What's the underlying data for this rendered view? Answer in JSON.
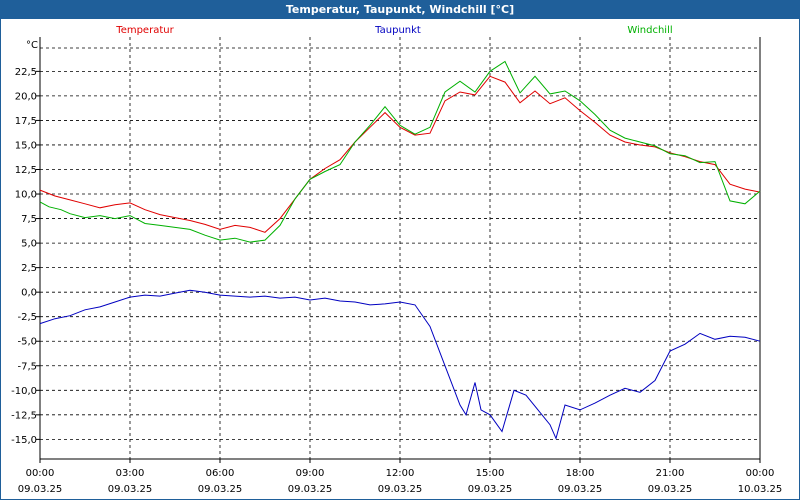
{
  "window": {
    "title": "Temperatur, Taupunkt, Windchill [°C]"
  },
  "chart_data": {
    "type": "line",
    "title": "Temperatur, Taupunkt, Windchill [°C]",
    "ylabel": "°C",
    "ylim": [
      -17,
      26
    ],
    "xlim": [
      0,
      24
    ],
    "grid": true,
    "legend_position": "top",
    "y_ticks": [
      {
        "value": 22.5,
        "label": "22,5"
      },
      {
        "value": 20.0,
        "label": "20,0"
      },
      {
        "value": 17.5,
        "label": "17,5"
      },
      {
        "value": 15.0,
        "label": "15,0"
      },
      {
        "value": 12.5,
        "label": "12,5"
      },
      {
        "value": 10.0,
        "label": "10,0"
      },
      {
        "value": 7.5,
        "label": "7,5"
      },
      {
        "value": 5.0,
        "label": "5,0"
      },
      {
        "value": 2.5,
        "label": "2,5"
      },
      {
        "value": 0.0,
        "label": "0,0"
      },
      {
        "value": -2.5,
        "label": "-2,5"
      },
      {
        "value": -5.0,
        "label": "-5,0"
      },
      {
        "value": -7.5,
        "label": "-7,5"
      },
      {
        "value": -10.0,
        "label": "-10,0"
      },
      {
        "value": -12.5,
        "label": "-12,5"
      },
      {
        "value": -15.0,
        "label": "-15,0"
      }
    ],
    "x_ticks": [
      {
        "value": 0,
        "time": "00:00",
        "date": "09.03.25"
      },
      {
        "value": 3,
        "time": "03:00",
        "date": "09.03.25"
      },
      {
        "value": 6,
        "time": "06:00",
        "date": "09.03.25"
      },
      {
        "value": 9,
        "time": "09:00",
        "date": "09.03.25"
      },
      {
        "value": 12,
        "time": "12:00",
        "date": "09.03.25"
      },
      {
        "value": 15,
        "time": "15:00",
        "date": "09.03.25"
      },
      {
        "value": 18,
        "time": "18:00",
        "date": "09.03.25"
      },
      {
        "value": 21,
        "time": "21:00",
        "date": "09.03.25"
      },
      {
        "value": 24,
        "time": "00:00",
        "date": "10.03.25"
      }
    ],
    "series": [
      {
        "name": "Temperatur",
        "color": "#e00000",
        "points": [
          [
            0,
            10.4
          ],
          [
            0.5,
            9.8
          ],
          [
            1,
            9.4
          ],
          [
            1.5,
            9.0
          ],
          [
            2,
            8.6
          ],
          [
            2.5,
            8.9
          ],
          [
            3,
            9.1
          ],
          [
            3.5,
            8.4
          ],
          [
            4,
            7.9
          ],
          [
            4.5,
            7.6
          ],
          [
            5,
            7.3
          ],
          [
            5.5,
            6.9
          ],
          [
            6,
            6.4
          ],
          [
            6.5,
            6.8
          ],
          [
            7,
            6.6
          ],
          [
            7.5,
            6.1
          ],
          [
            8,
            7.5
          ],
          [
            8.5,
            9.5
          ],
          [
            9,
            11.5
          ],
          [
            9.5,
            12.6
          ],
          [
            10,
            13.5
          ],
          [
            10.5,
            15.3
          ],
          [
            11,
            16.8
          ],
          [
            11.5,
            18.3
          ],
          [
            12,
            16.8
          ],
          [
            12.5,
            16.0
          ],
          [
            13,
            16.2
          ],
          [
            13.5,
            19.5
          ],
          [
            14,
            20.4
          ],
          [
            14.5,
            20.1
          ],
          [
            15,
            22.0
          ],
          [
            15.5,
            21.4
          ],
          [
            16,
            19.3
          ],
          [
            16.5,
            20.5
          ],
          [
            17,
            19.2
          ],
          [
            17.5,
            19.8
          ],
          [
            18,
            18.5
          ],
          [
            18.5,
            17.3
          ],
          [
            19,
            16.0
          ],
          [
            19.5,
            15.3
          ],
          [
            20,
            15.0
          ],
          [
            20.5,
            14.8
          ],
          [
            21,
            14.2
          ],
          [
            21.5,
            13.8
          ],
          [
            22,
            13.3
          ],
          [
            22.5,
            13.0
          ],
          [
            23,
            11.0
          ],
          [
            23.5,
            10.5
          ],
          [
            24,
            10.2
          ]
        ]
      },
      {
        "name": "Taupunkt",
        "color": "#0000c0",
        "points": [
          [
            0,
            -3.2
          ],
          [
            0.5,
            -2.7
          ],
          [
            1,
            -2.4
          ],
          [
            1.5,
            -1.8
          ],
          [
            2,
            -1.5
          ],
          [
            2.5,
            -1.0
          ],
          [
            3,
            -0.5
          ],
          [
            3.5,
            -0.3
          ],
          [
            4,
            -0.4
          ],
          [
            4.5,
            -0.1
          ],
          [
            5,
            0.2
          ],
          [
            5.5,
            0.0
          ],
          [
            6,
            -0.3
          ],
          [
            6.5,
            -0.4
          ],
          [
            7,
            -0.5
          ],
          [
            7.5,
            -0.4
          ],
          [
            8,
            -0.6
          ],
          [
            8.5,
            -0.5
          ],
          [
            9,
            -0.8
          ],
          [
            9.5,
            -0.6
          ],
          [
            10,
            -0.9
          ],
          [
            10.5,
            -1.0
          ],
          [
            11,
            -1.3
          ],
          [
            11.5,
            -1.2
          ],
          [
            12,
            -1.0
          ],
          [
            12.5,
            -1.3
          ],
          [
            13,
            -3.5
          ],
          [
            13.5,
            -7.5
          ],
          [
            14,
            -11.5
          ],
          [
            14.2,
            -12.5
          ],
          [
            14.5,
            -9.2
          ],
          [
            14.7,
            -12.0
          ],
          [
            15,
            -12.5
          ],
          [
            15.4,
            -14.2
          ],
          [
            15.8,
            -10.0
          ],
          [
            16.2,
            -10.5
          ],
          [
            16.6,
            -12.0
          ],
          [
            17,
            -13.5
          ],
          [
            17.2,
            -14.9
          ],
          [
            17.5,
            -11.5
          ],
          [
            18,
            -12.0
          ],
          [
            18.5,
            -11.3
          ],
          [
            19,
            -10.5
          ],
          [
            19.5,
            -9.8
          ],
          [
            20,
            -10.2
          ],
          [
            20.5,
            -9.0
          ],
          [
            21,
            -6.0
          ],
          [
            21.5,
            -5.3
          ],
          [
            22,
            -4.2
          ],
          [
            22.5,
            -4.8
          ],
          [
            23,
            -4.5
          ],
          [
            23.5,
            -4.6
          ],
          [
            24,
            -5.0
          ]
        ]
      },
      {
        "name": "Windchill",
        "color": "#00b000",
        "points": [
          [
            0,
            9.2
          ],
          [
            0.3,
            8.7
          ],
          [
            0.7,
            8.4
          ],
          [
            1,
            8.0
          ],
          [
            1.5,
            7.6
          ],
          [
            2,
            7.8
          ],
          [
            2.5,
            7.5
          ],
          [
            3,
            7.8
          ],
          [
            3.5,
            7.0
          ],
          [
            4,
            6.8
          ],
          [
            4.5,
            6.6
          ],
          [
            5,
            6.4
          ],
          [
            5.5,
            5.8
          ],
          [
            6,
            5.3
          ],
          [
            6.5,
            5.5
          ],
          [
            7,
            5.1
          ],
          [
            7.5,
            5.3
          ],
          [
            8,
            6.8
          ],
          [
            8.5,
            9.5
          ],
          [
            9,
            11.5
          ],
          [
            9.5,
            12.3
          ],
          [
            10,
            13.0
          ],
          [
            10.5,
            15.3
          ],
          [
            11,
            17.0
          ],
          [
            11.5,
            18.9
          ],
          [
            12,
            17.0
          ],
          [
            12.5,
            16.1
          ],
          [
            13,
            16.8
          ],
          [
            13.5,
            20.4
          ],
          [
            14,
            21.5
          ],
          [
            14.5,
            20.4
          ],
          [
            15,
            22.5
          ],
          [
            15.5,
            23.5
          ],
          [
            16,
            20.3
          ],
          [
            16.5,
            22.0
          ],
          [
            17,
            20.2
          ],
          [
            17.5,
            20.5
          ],
          [
            18,
            19.5
          ],
          [
            18.5,
            18.1
          ],
          [
            19,
            16.5
          ],
          [
            19.5,
            15.7
          ],
          [
            20,
            15.3
          ],
          [
            20.5,
            14.9
          ],
          [
            21,
            14.1
          ],
          [
            21.5,
            13.9
          ],
          [
            22,
            13.2
          ],
          [
            22.5,
            13.3
          ],
          [
            23,
            9.3
          ],
          [
            23.5,
            9.0
          ],
          [
            24,
            10.3
          ]
        ]
      }
    ]
  }
}
